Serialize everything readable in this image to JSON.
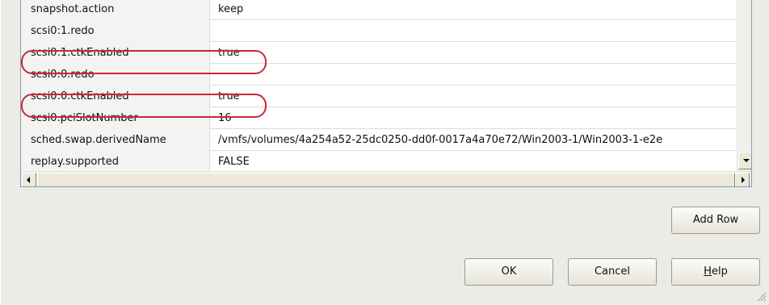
{
  "grid": {
    "rows": [
      {
        "key": "snapshot.action",
        "value": "keep"
      },
      {
        "key": "scsi0:1.redo",
        "value": ""
      },
      {
        "key": "scsi0:1.ctkEnabled",
        "value": "true"
      },
      {
        "key": "scsi0:0.redo",
        "value": ""
      },
      {
        "key": "scsi0:0.ctkEnabled",
        "value": "true"
      },
      {
        "key": "scsi0.pciSlotNumber",
        "value": "16"
      },
      {
        "key": "sched.swap.derivedName",
        "value": "/vmfs/volumes/4a254a52-25dc0250-dd0f-0017a4a70e72/Win2003-1/Win2003-1-e2e"
      },
      {
        "key": "replay.supported",
        "value": "FALSE"
      }
    ]
  },
  "buttons": {
    "add_row": "Add Row",
    "ok": "OK",
    "cancel": "Cancel",
    "help_prefix": "H",
    "help_rest": "elp"
  },
  "colors": {
    "highlight": "#c8283a",
    "grid_border": "#7f9db9",
    "dialog_bg": "#ecebe6"
  },
  "icons": {
    "scroll_down": "chevron-down-icon",
    "scroll_left": "chevron-left-icon",
    "scroll_right": "chevron-right-icon",
    "resize_grip": "resize-grip-icon"
  }
}
